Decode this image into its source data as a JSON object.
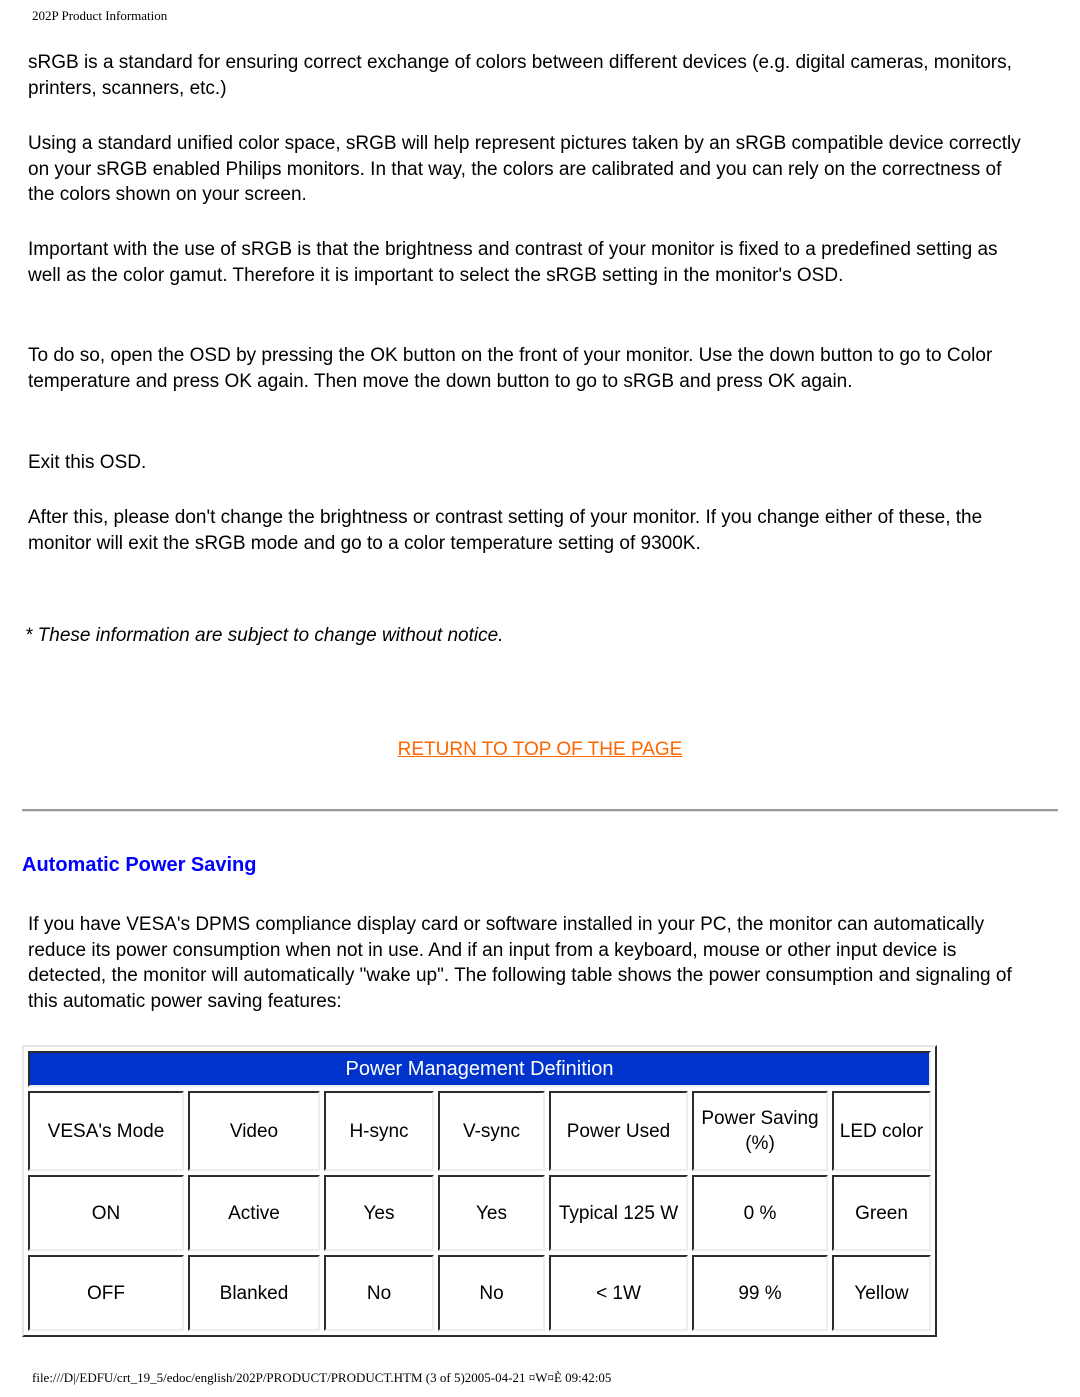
{
  "header": {
    "title": "202P Product Information"
  },
  "paragraphs": [
    "sRGB is a standard for ensuring correct exchange of colors between different devices (e.g. digital cameras, monitors, printers, scanners, etc.)",
    "Using a standard unified color space, sRGB will help represent pictures taken by an sRGB compatible device correctly on your sRGB enabled Philips monitors. In that way, the colors are calibrated and you can rely on the correctness of the colors shown on your screen.",
    "Important with the use of sRGB is that the brightness and contrast of your monitor is fixed to a predefined setting as well as the color gamut. Therefore it is important to select the sRGB setting in the monitor's OSD.",
    "To do so, open the OSD by pressing the OK button on the front of your monitor. Use the down button to go to Color temperature and press OK again. Then move the down button to go to sRGB and press OK again.",
    "Exit this OSD.",
    "After this, please don't change the brightness or contrast setting of your monitor. If you change either of these, the monitor will exit the sRGB mode and go to a color temperature setting of 9300K."
  ],
  "note": "* These information are subject to change without notice.",
  "return_link": "RETURN TO TOP OF THE PAGE",
  "section": {
    "title": "Automatic Power Saving",
    "intro": "If you have VESA's DPMS compliance display card or software installed in your PC, the monitor can automatically reduce its power consumption when not in use. And if an input from a keyboard, mouse or other input device is detected, the monitor will automatically \"wake up\". The following table shows the power consumption and signaling of this automatic power saving features:"
  },
  "table": {
    "title": "Power Management Definition",
    "columns": [
      "VESA's Mode",
      "Video",
      "H-sync",
      "V-sync",
      "Power Used",
      "Power Saving (%)",
      "LED color"
    ],
    "rows": [
      [
        "ON",
        "Active",
        "Yes",
        "Yes",
        "Typical 125 W",
        "0 %",
        "Green"
      ],
      [
        "OFF",
        "Blanked",
        "No",
        "No",
        "< 1W",
        "99 %",
        "Yellow"
      ]
    ]
  },
  "colors": {
    "link": "#ff6600",
    "heading": "#0000ff",
    "table_title_bg": "#0033cc"
  },
  "footer": {
    "path": "file:///D|/EDFU/crt_19_5/edoc/english/202P/PRODUCT/PRODUCT.HTM (3 of 5)2005-04-21 ¤W¤È 09:42:05"
  }
}
